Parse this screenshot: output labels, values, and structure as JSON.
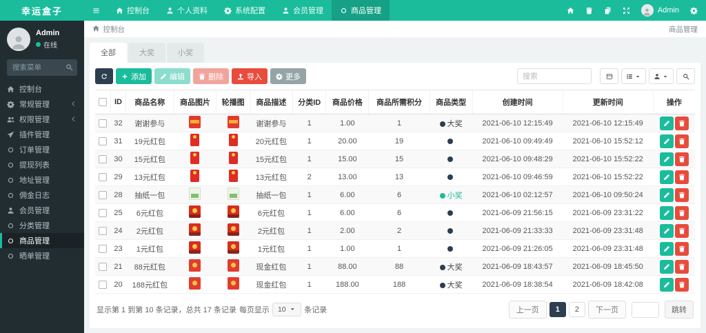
{
  "brand": {
    "logo": "幸运盒子"
  },
  "colors": {
    "accent": "#1abc9c",
    "navy": "#2c3e50",
    "red": "#e74c3c",
    "sidebar": "#222d32",
    "green_text": "#1abc9c",
    "dark_text": "#444444"
  },
  "sidebar": {
    "user": {
      "name": "Admin",
      "status": "在线"
    },
    "search_placeholder": "搜索菜单",
    "menu": [
      {
        "key": "dashboard",
        "label": "控制台",
        "icon": "home"
      },
      {
        "key": "general",
        "label": "常规管理",
        "icon": "gear",
        "expandable": true
      },
      {
        "key": "auth",
        "label": "权限管理",
        "icon": "users",
        "expandable": true
      },
      {
        "key": "addon",
        "label": "插件管理",
        "icon": "plane"
      },
      {
        "key": "order",
        "label": "订单管理",
        "icon": "circle"
      },
      {
        "key": "withdraw",
        "label": "提现列表",
        "icon": "circle"
      },
      {
        "key": "address",
        "label": "地址管理",
        "icon": "circle"
      },
      {
        "key": "commission",
        "label": "佣金日志",
        "icon": "circle"
      },
      {
        "key": "member",
        "label": "会员管理",
        "icon": "user"
      },
      {
        "key": "category",
        "label": "分类管理",
        "icon": "circle"
      },
      {
        "key": "goods",
        "label": "商品管理",
        "icon": "circle",
        "active": true
      },
      {
        "key": "review",
        "label": "晒单管理",
        "icon": "circle"
      }
    ]
  },
  "topbar": {
    "nav": [
      {
        "key": "dashboard",
        "label": "控制台",
        "icon": "home"
      },
      {
        "key": "profile",
        "label": "个人资料",
        "icon": "user"
      },
      {
        "key": "config",
        "label": "系统配置",
        "icon": "gear"
      },
      {
        "key": "member",
        "label": "会员管理",
        "icon": "user"
      },
      {
        "key": "goods",
        "label": "商品管理",
        "icon": "circle",
        "active": true
      }
    ],
    "right_icons": [
      {
        "key": "home-shortcut",
        "icon": "home"
      },
      {
        "key": "clear-cache",
        "icon": "trash"
      },
      {
        "key": "docs",
        "icon": "copy"
      },
      {
        "key": "fullscreen",
        "icon": "expand"
      }
    ],
    "user_label": "Admin"
  },
  "breadcrumb": {
    "left": "控制台",
    "right": "商品管理"
  },
  "tabs": [
    {
      "key": "all",
      "label": "全部",
      "active": true
    },
    {
      "key": "big-prize",
      "label": "大奖"
    },
    {
      "key": "small-prize",
      "label": "小奖"
    }
  ],
  "toolbar": {
    "buttons": [
      {
        "key": "refresh",
        "label": "",
        "icon": "refresh",
        "style": "navy"
      },
      {
        "key": "add",
        "label": "添加",
        "icon": "plus",
        "style": "green"
      },
      {
        "key": "edit",
        "label": "编辑",
        "icon": "pencil",
        "style": "green",
        "disabled": true
      },
      {
        "key": "delete",
        "label": "删除",
        "icon": "trash",
        "style": "red",
        "disabled": true
      },
      {
        "key": "import",
        "label": "导入",
        "icon": "upload",
        "style": "red"
      },
      {
        "key": "more",
        "label": "更多",
        "icon": "gear",
        "style": "gray"
      }
    ],
    "search_placeholder": "搜索",
    "mini_buttons": [
      {
        "key": "view-toggle",
        "icon": "card"
      },
      {
        "key": "columns",
        "icon": "columns",
        "caret": true
      },
      {
        "key": "export",
        "icon": "user",
        "caret": true
      },
      {
        "key": "search-toggle",
        "icon": "search"
      }
    ]
  },
  "table": {
    "columns": [
      "",
      "ID",
      "商品名称",
      "商品图片",
      "轮播图",
      "商品描述",
      "分类ID",
      "商品价格",
      "商品所需积分",
      "商品类型",
      "创建时间",
      "更新时间",
      "操作"
    ],
    "rows": [
      {
        "id": "32",
        "name": "谢谢参与",
        "image": "red-band",
        "desc": "谢谢参与",
        "category_id": "1",
        "price": "1.00",
        "points": "1",
        "type": {
          "color": "dark",
          "label": "大奖"
        },
        "created": "2021-06-10 12:15:49",
        "updated": "2021-06-10 12:15:49"
      },
      {
        "id": "31",
        "name": "19元红包",
        "image": "red-card",
        "desc": "20元红包",
        "category_id": "1",
        "price": "20.00",
        "points": "19",
        "type": {
          "color": "dark",
          "label": ""
        },
        "created": "2021-06-10 09:49:49",
        "updated": "2021-06-10 15:52:12"
      },
      {
        "id": "30",
        "name": "15元红包",
        "image": "red-card",
        "desc": "15元红包",
        "category_id": "1",
        "price": "15.00",
        "points": "15",
        "type": {
          "color": "dark",
          "label": ""
        },
        "created": "2021-06-10 09:48:29",
        "updated": "2021-06-10 15:52:22"
      },
      {
        "id": "29",
        "name": "13元红包",
        "image": "red-card",
        "desc": "13元红包",
        "category_id": "2",
        "price": "13.00",
        "points": "13",
        "type": {
          "color": "dark",
          "label": ""
        },
        "created": "2021-06-10 09:46:59",
        "updated": "2021-06-10 15:52:22"
      },
      {
        "id": "28",
        "name": "抽纸一包",
        "image": "tissue",
        "desc": "抽纸一包",
        "category_id": "1",
        "price": "6.00",
        "points": "6",
        "type": {
          "color": "green",
          "label": "小奖"
        },
        "created": "2021-06-10 02:12:57",
        "updated": "2021-06-10 09:50:24"
      },
      {
        "id": "25",
        "name": "6元红包",
        "image": "red-gold",
        "desc": "6元红包",
        "category_id": "1",
        "price": "6.00",
        "points": "6",
        "type": {
          "color": "dark",
          "label": ""
        },
        "created": "2021-06-09 21:56:15",
        "updated": "2021-06-09 23:31:22"
      },
      {
        "id": "24",
        "name": "2元红包",
        "image": "red-gold",
        "desc": "2元红包",
        "category_id": "1",
        "price": "2.00",
        "points": "2",
        "type": {
          "color": "dark",
          "label": ""
        },
        "created": "2021-06-09 21:33:33",
        "updated": "2021-06-09 23:31:48"
      },
      {
        "id": "23",
        "name": "1元红包",
        "image": "red-gold",
        "desc": "1元红包",
        "category_id": "1",
        "price": "1.00",
        "points": "1",
        "type": {
          "color": "dark",
          "label": ""
        },
        "created": "2021-06-09 21:26:05",
        "updated": "2021-06-09 23:31:48"
      },
      {
        "id": "21",
        "name": "88元红包",
        "image": "red-envelope",
        "desc": "现金红包",
        "category_id": "1",
        "price": "88.00",
        "points": "88",
        "type": {
          "color": "dark",
          "label": "大奖"
        },
        "created": "2021-06-09 18:43:57",
        "updated": "2021-06-09 18:45:50"
      },
      {
        "id": "20",
        "name": "188元红包",
        "image": "red-envelope",
        "desc": "现金红包",
        "category_id": "1",
        "price": "188.00",
        "points": "188",
        "type": {
          "color": "dark",
          "label": "大奖"
        },
        "created": "2021-06-09 18:38:54",
        "updated": "2021-06-09 18:42:08"
      }
    ]
  },
  "footer": {
    "summary": "显示第 1 到第 10 条记录，总共 17 条记录",
    "per_page_label": "每页显示",
    "per_page_value": "10",
    "records_label": "条记录",
    "pagination": {
      "prev": "上一页",
      "pages": [
        "1",
        "2"
      ],
      "active": "1",
      "next": "下一页",
      "jump": "跳转"
    }
  }
}
